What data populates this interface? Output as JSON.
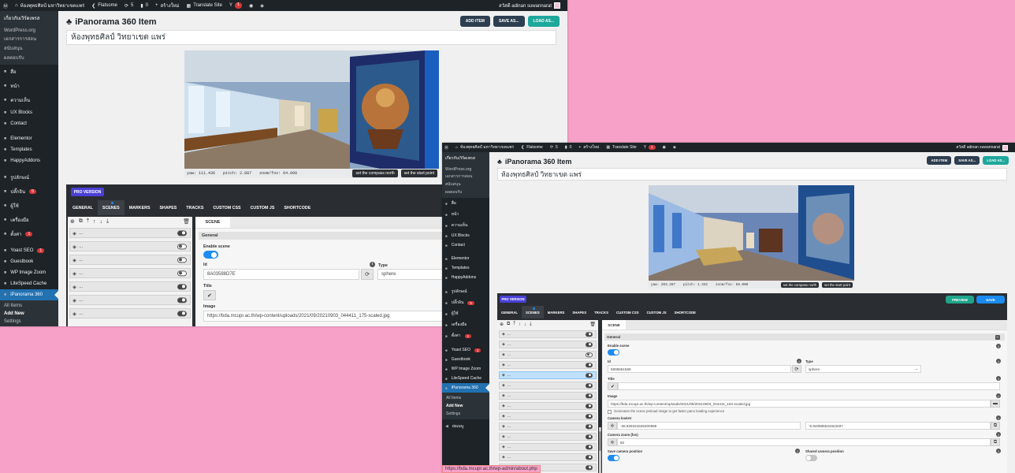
{
  "admin_bar": {
    "site_name": "ห้องพุทธศิลป์ มหาวิทยาเขตแพร่",
    "theme": "Flatsome",
    "updates_count": "5",
    "comments_count": "0",
    "new_label": "สร้างใหม่",
    "translate_label": "Translate Site",
    "notif_count": "1",
    "howdy": "สวัสดี adinan suwannarat"
  },
  "sidebar": {
    "about_label": "เกี่ยวกับเวิร์ดเพรส",
    "sub_items": [
      "WordPress.org",
      "เอกสารการสอน",
      "สนับสนุน",
      "ผลตอบรับ"
    ],
    "items": [
      {
        "label": "สื่อ",
        "icon": "media-icon"
      },
      {
        "label": "หน้า",
        "icon": "pages-icon"
      },
      {
        "label": "ความเห็น",
        "icon": "comments-icon"
      },
      {
        "label": "UX Blocks",
        "icon": "ux-blocks-icon"
      },
      {
        "label": "Contact",
        "icon": "envelope-icon"
      },
      {
        "label": "Elementor",
        "icon": "elementor-icon"
      },
      {
        "label": "Templates",
        "icon": "templates-icon"
      },
      {
        "label": "HappyAddons",
        "icon": "happyaddons-icon"
      },
      {
        "label": "รูปลักษณ์",
        "icon": "appearance-icon"
      },
      {
        "label": "ปลั๊กอิน",
        "icon": "plugins-icon",
        "badge": "5"
      },
      {
        "label": "ผู้ใช้",
        "icon": "users-icon"
      },
      {
        "label": "เครื่องมือ",
        "icon": "tools-icon"
      },
      {
        "label": "ตั้งค่า",
        "icon": "settings-icon",
        "badge": "1"
      },
      {
        "label": "Yoast SEO",
        "icon": "yoast-icon",
        "badge": "1"
      },
      {
        "label": "Guestbook",
        "icon": "guestbook-icon"
      },
      {
        "label": "WP Image Zoom",
        "icon": "zoom-icon"
      },
      {
        "label": "LiteSpeed Cache",
        "icon": "litespeed-icon"
      },
      {
        "label": "iPanorama 360",
        "icon": "ipanorama-icon",
        "active": true
      }
    ],
    "panorama_sub": [
      "All Items",
      "Add New",
      "Settings"
    ],
    "collapse_label": "ย่อเมนู"
  },
  "page": {
    "title": "iPanorama 360 Item",
    "buttons": {
      "add": "ADD ITEM",
      "save_as": "SAVE AS...",
      "load_as": "LOAD AS...",
      "load_as_short": "LOAD AS..."
    },
    "item_name_w1": "ห้องพุทธศิลป์ วิทยาเขต แพร่",
    "item_name_w2": "ห้องพุทธศิลป์ วิทยาเขต แพร่"
  },
  "pano_w1": {
    "yaw_label": "yaw:",
    "yaw": "111.436",
    "pitch_label": "pitch:",
    "pitch": "2.887",
    "zoom_label": "zoom/fov:",
    "zoom": "64.000",
    "compass_btn": "set the compass north",
    "start_btn": "set the start point"
  },
  "pano_w2": {
    "yaw_label": "yaw:",
    "yaw": "203.287",
    "pitch_label": "pitch:",
    "pitch": "1.332",
    "zoom_label": "zoom/fov:",
    "zoom": "58.000",
    "compass_btn": "set the compass north",
    "start_btn": "set the start point"
  },
  "editor": {
    "pro_label": "PRO VERSION",
    "preview_label": "PREVIEW",
    "save_label": "SAVE",
    "tabs": [
      "GENERAL",
      "SCENES",
      "MARKERS",
      "SHAPES",
      "TRACKS",
      "CUSTOM CSS",
      "CUSTOM JS",
      "SHORTCODE"
    ],
    "scenes_count_w1": "12",
    "scenes_count_w2": "16",
    "scene_label": "...",
    "scene_tab": "SCENE",
    "general_section": "General",
    "enable_scene": "Enable scene",
    "id_label": "Id",
    "id_w1": "8A03588D7E",
    "id_w2": "5905661569",
    "type_label": "Type",
    "type_value": "sphere",
    "title_label": "Title",
    "image_label": "Image",
    "image_w1": "https://bda.mcupr.ac.th/wp-content/uploads/2021/09/20210903_044411_175-scaled.jpg",
    "image_w2": "https://bda.mcupr.ac.th/wp-content/uploads/2021/09/20210903_044411_194-scaled.jpg",
    "preload_label": "Generates the scene preload image to get faster pano loading experience",
    "lookat_label": "Camera lookAt",
    "lookat_x": "-36.929331535300988",
    "lookat_y": "-5.94058553192349?",
    "zoom_label": "Camera zoom (fov)",
    "zoom_value": "60",
    "save_cam_label": "Save camera position",
    "shared_cam_label": "Shared camera position"
  },
  "status_url": "https://bda.mcupr.ac.th/wp-admin/about.php",
  "colors": {
    "accent": "#2271b1",
    "pro": "#4a40d6",
    "toggle": "#1e8cf0",
    "bg": "#f7a1c8"
  }
}
